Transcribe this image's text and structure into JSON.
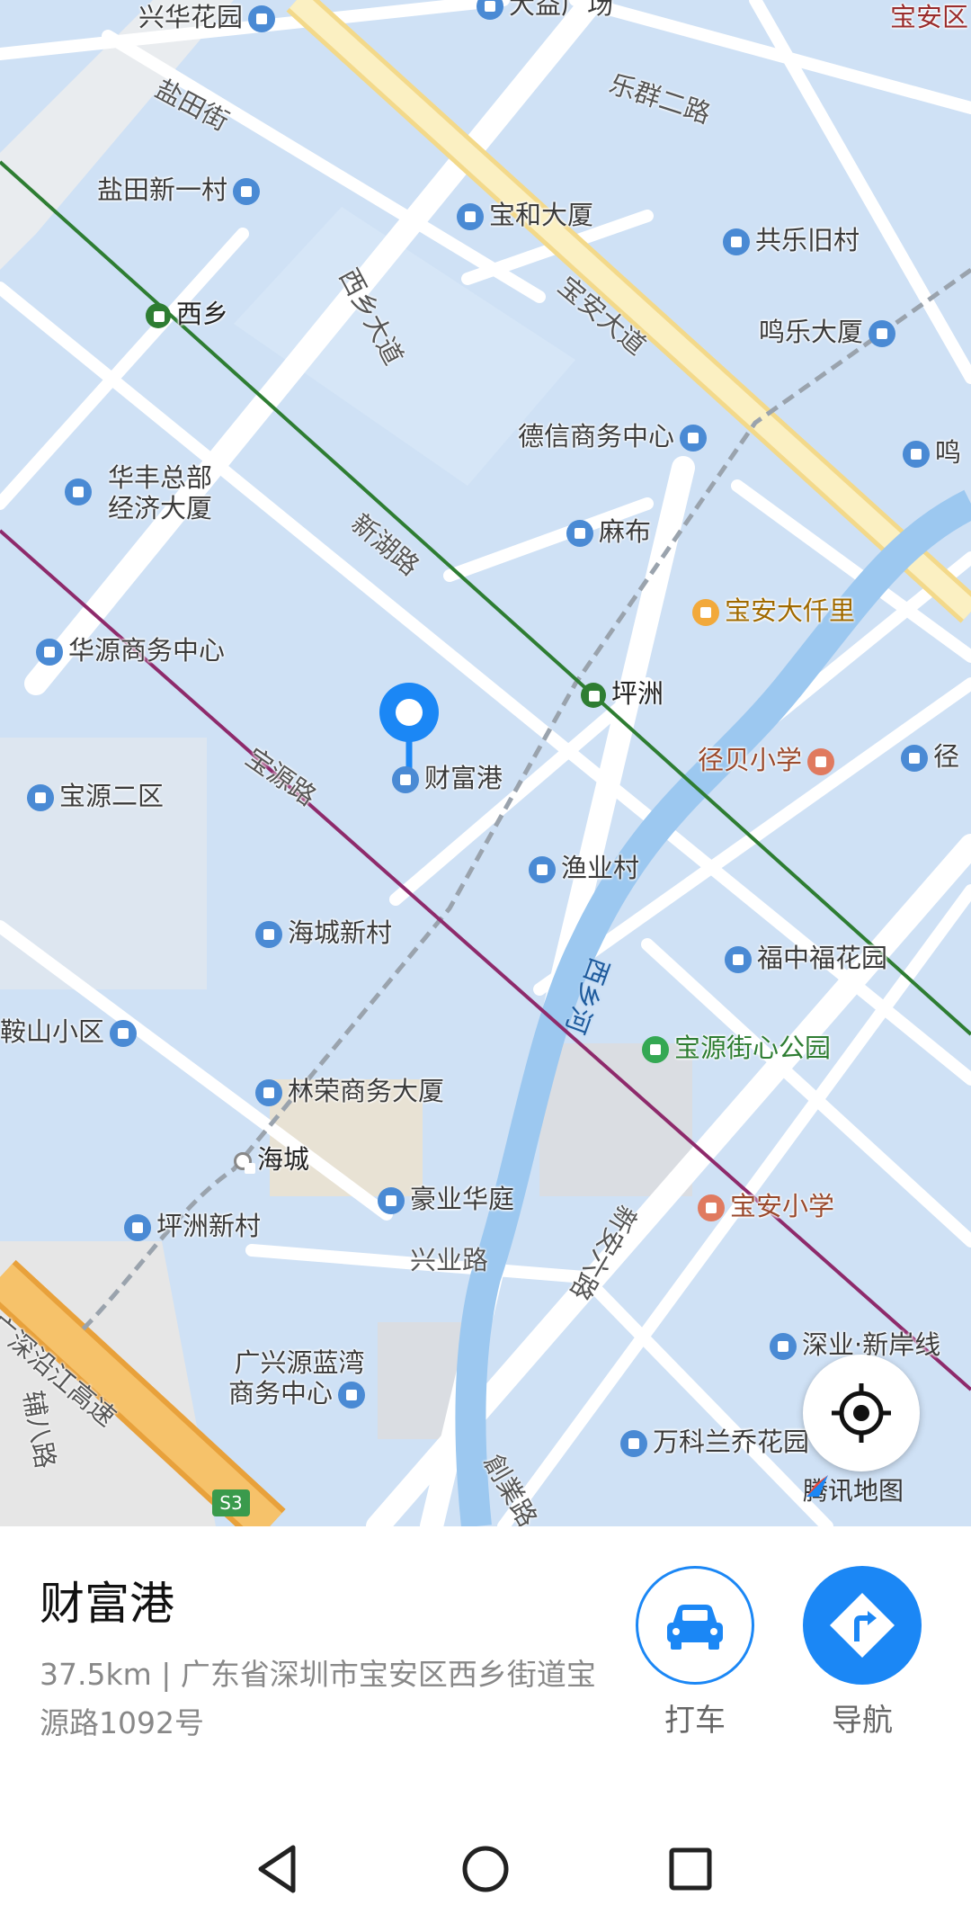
{
  "map": {
    "pois": [
      {
        "text": "兴华花园",
        "type": "building"
      },
      {
        "text": "大益广场",
        "type": "building"
      },
      {
        "text": "宝安区",
        "type": "district"
      },
      {
        "text": "盐田新一村",
        "type": "building"
      },
      {
        "text": "宝和大厦",
        "type": "building"
      },
      {
        "text": "共乐旧村",
        "type": "building"
      },
      {
        "text": "西乡",
        "type": "metro"
      },
      {
        "text": "鸣乐大厦",
        "type": "building"
      },
      {
        "text": "德信商务中心",
        "type": "building"
      },
      {
        "text": "华丰总部",
        "type": "building"
      },
      {
        "text": "经济大厦",
        "type": "building"
      },
      {
        "text": "麻布",
        "type": "building"
      },
      {
        "text": "宝安大仟里",
        "type": "mall"
      },
      {
        "text": "华源商务中心",
        "type": "building"
      },
      {
        "text": "坪洲",
        "type": "metro"
      },
      {
        "text": "财富港",
        "type": "building"
      },
      {
        "text": "径贝小学",
        "type": "school"
      },
      {
        "text": "宝源二区",
        "type": "building"
      },
      {
        "text": "渔业村",
        "type": "building"
      },
      {
        "text": "海城新村",
        "type": "building"
      },
      {
        "text": "福中福花园",
        "type": "building"
      },
      {
        "text": "鞍山小区",
        "type": "building"
      },
      {
        "text": "宝源街心公园",
        "type": "park"
      },
      {
        "text": "林荣商务大厦",
        "type": "building"
      },
      {
        "text": "海城",
        "type": "station"
      },
      {
        "text": "豪业华庭",
        "type": "building"
      },
      {
        "text": "宝安小学",
        "type": "school"
      },
      {
        "text": "坪洲新村",
        "type": "building"
      },
      {
        "text": "广兴源蓝湾",
        "type": "building"
      },
      {
        "text": "商务中心",
        "type": "building"
      },
      {
        "text": "深业·新岸线",
        "type": "building"
      },
      {
        "text": "万科兰乔花园",
        "type": "building"
      },
      {
        "text": "鸣",
        "type": "building"
      },
      {
        "text": "径",
        "type": "building"
      }
    ],
    "roads": [
      "盐田街",
      "乐群二路",
      "西乡大道",
      "宝安大道",
      "新湖路",
      "宝源路",
      "西乡河",
      "兴业路",
      "新安六路",
      "广深沿江高速",
      "辅八路",
      "創業路",
      "S3"
    ],
    "brand": "腾讯地图",
    "locate_icon": "crosshair-icon",
    "colors": {
      "road_yellow": "#f5e6a8",
      "metro_green": "#2e7d32",
      "metro_purple": "#8e2a6b",
      "pin": "#1b87f5",
      "river": "#9cc8f0"
    }
  },
  "panel": {
    "name": "财富港",
    "address": "37.5km | 广东省深圳市宝安区西乡街道宝源路1092号",
    "taxi_label": "打车",
    "nav_label": "导航",
    "accent": "#1b87f5"
  },
  "navbar": {
    "back_icon": "back-triangle-icon",
    "home_icon": "home-circle-icon",
    "recents_icon": "recents-square-icon"
  }
}
